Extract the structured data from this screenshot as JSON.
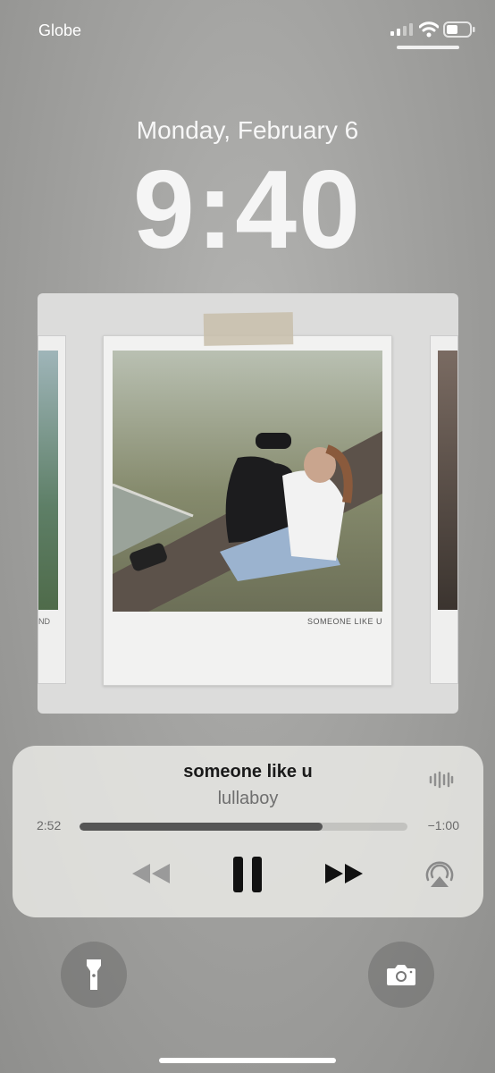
{
  "status_bar": {
    "carrier": "Globe"
  },
  "lock_screen": {
    "date": "Monday, February 6",
    "time": "9:40"
  },
  "artwork": {
    "caption": "SOMEONE LIKE U",
    "side_caption_left": "ND"
  },
  "now_playing": {
    "title": "someone like u",
    "artist": "lullaboy",
    "elapsed": "2:52",
    "remaining": "−1:00",
    "progress_fraction": 0.74
  },
  "icons": {
    "signal": "cellular-signal-icon",
    "wifi": "wifi-icon",
    "battery": "battery-icon",
    "waveform": "audio-waveform-icon",
    "rewind": "rewind-icon",
    "pause": "pause-icon",
    "forward": "fast-forward-icon",
    "airplay": "airplay-icon",
    "flashlight": "flashlight-icon",
    "camera": "camera-icon"
  }
}
